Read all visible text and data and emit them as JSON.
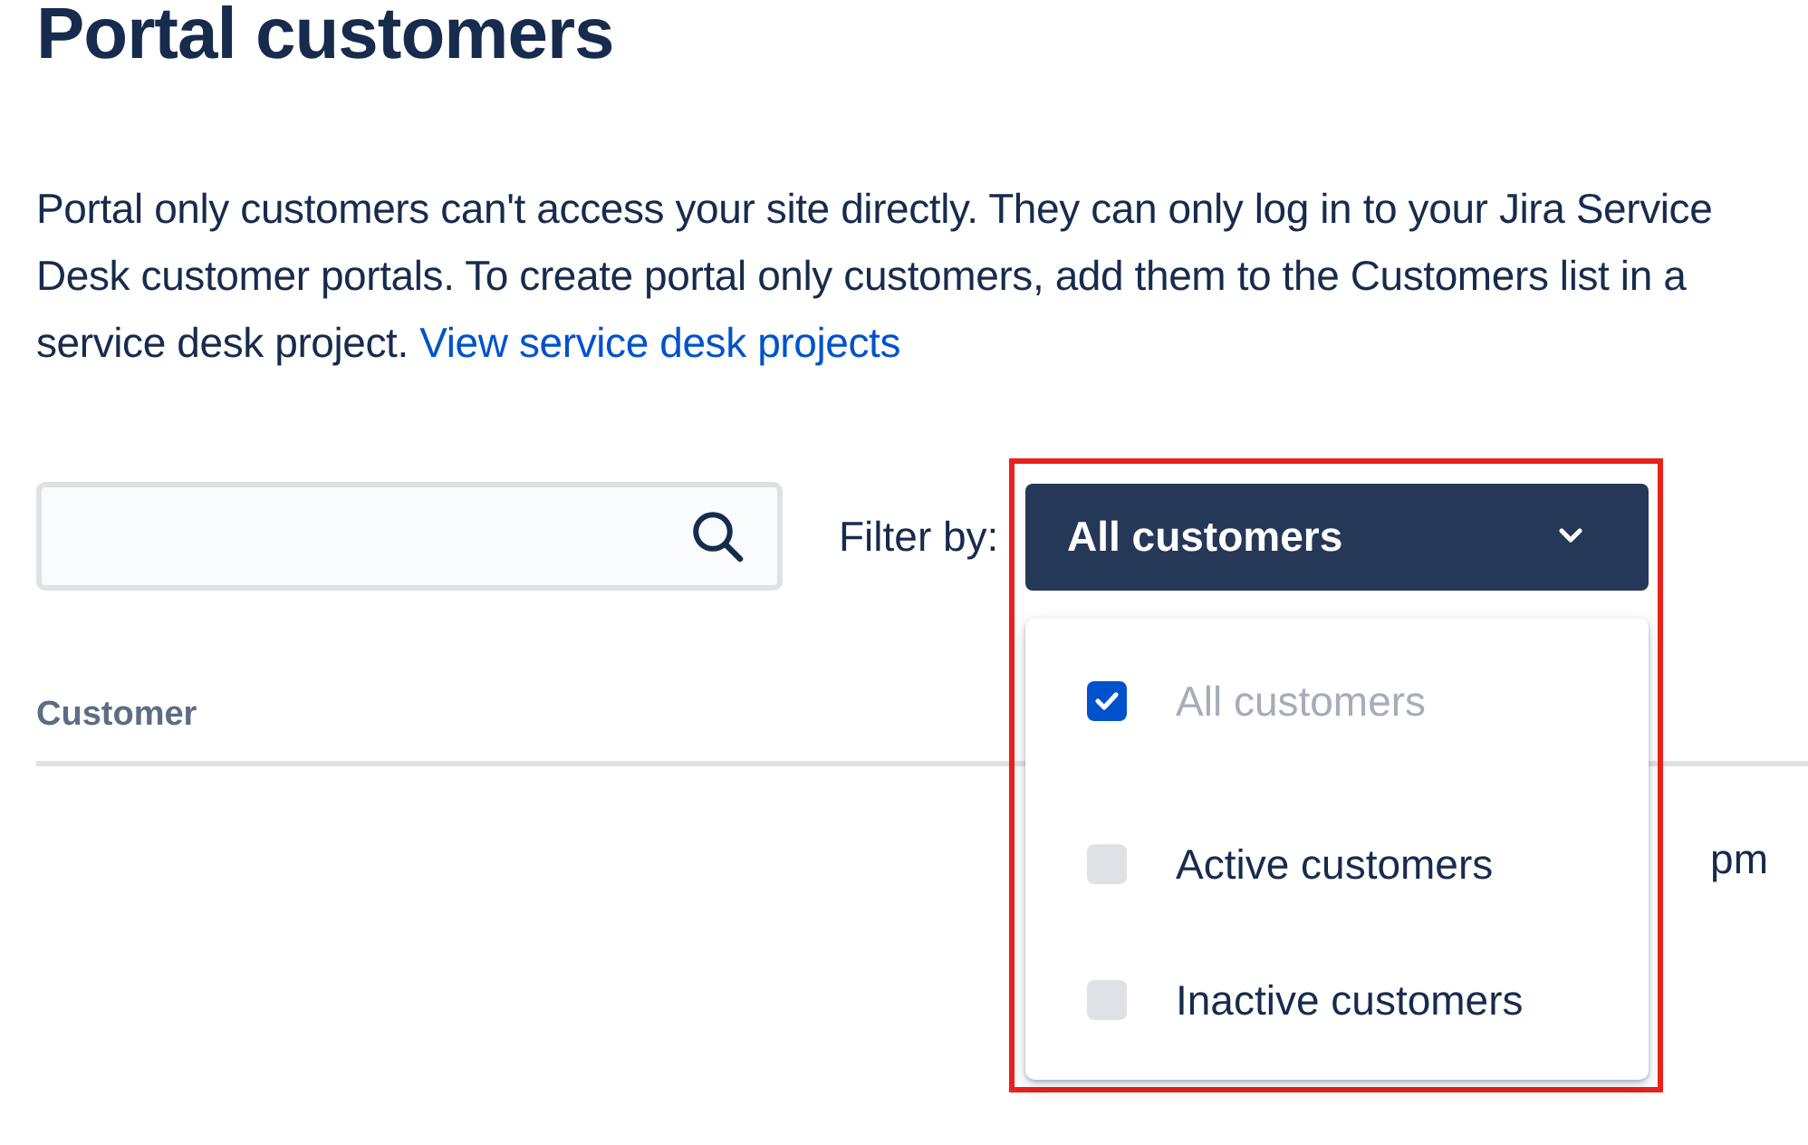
{
  "title": "Portal customers",
  "description": "Portal only customers can't access your site directly. They can only log in to your Jira Service Desk customer portals. To create portal only customers, add them to the Customers list in a service desk project.",
  "description_link": "View service desk projects",
  "filter": {
    "label": "Filter by:",
    "value": "All customers",
    "expanded": true,
    "options": [
      {
        "label": "All customers",
        "checked": true
      },
      {
        "label": "Active customers",
        "checked": false
      },
      {
        "label": "Inactive customers",
        "checked": false
      }
    ]
  },
  "table": {
    "columns": [
      "Customer"
    ],
    "rows": [
      {
        "column_2": "pm"
      }
    ]
  }
}
